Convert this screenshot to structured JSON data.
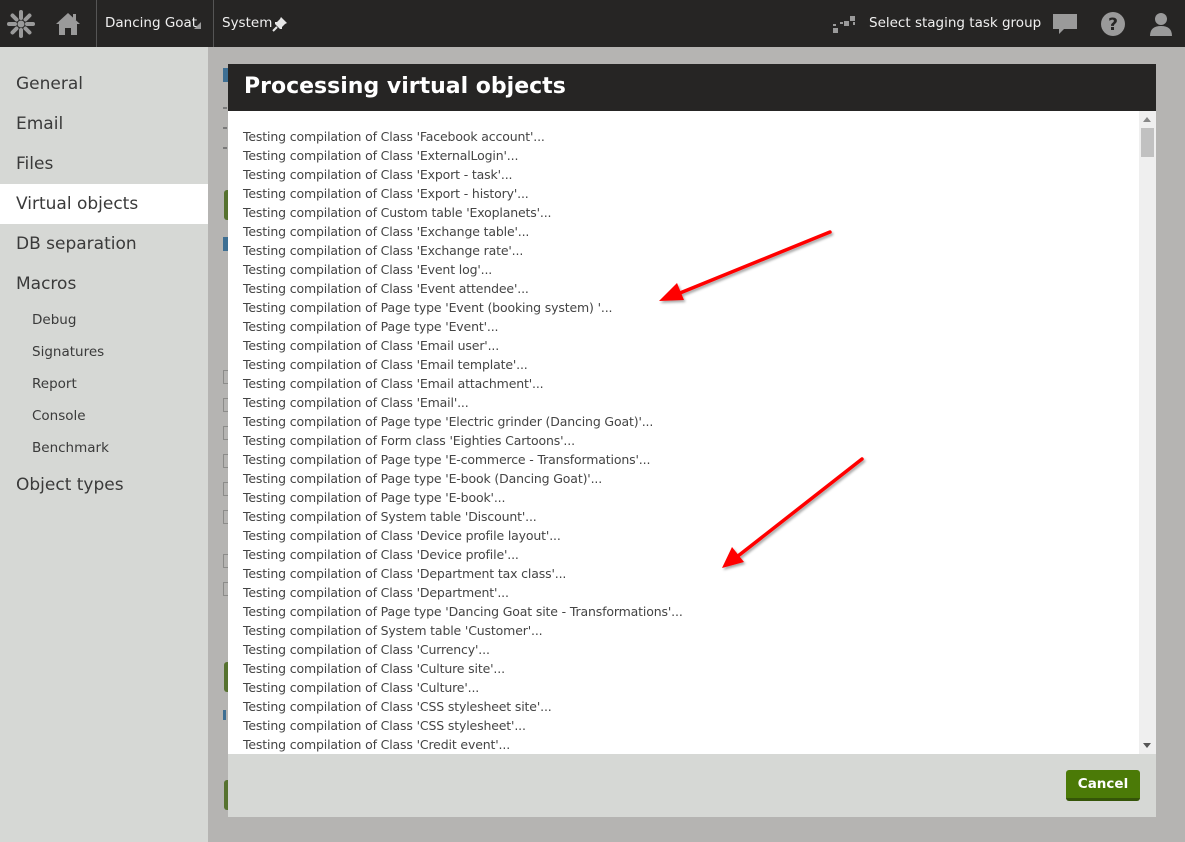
{
  "header": {
    "logo_icon": "kentico-logo-icon",
    "home_icon": "home-icon",
    "site_name": "Dancing Goat",
    "app_name": "System",
    "pin_icon": "pin-icon",
    "staging_label": "Select staging task group",
    "chat_icon": "chat-icon",
    "help_icon": "help-icon",
    "user_icon": "user-icon"
  },
  "sidebar": {
    "items": [
      {
        "label": "General"
      },
      {
        "label": "Email"
      },
      {
        "label": "Files"
      },
      {
        "label": "Virtual objects",
        "active": true
      },
      {
        "label": "DB separation"
      },
      {
        "label": "Macros"
      }
    ],
    "macro_subitems": [
      {
        "label": "Debug"
      },
      {
        "label": "Signatures"
      },
      {
        "label": "Report"
      },
      {
        "label": "Console"
      },
      {
        "label": "Benchmark"
      }
    ],
    "last_item": {
      "label": "Object types"
    }
  },
  "dialog": {
    "title": "Processing virtual objects",
    "log_lines": [
      "Testing compilation of Class 'Facebook account'...",
      "Testing compilation of Class 'ExternalLogin'...",
      "Testing compilation of Class 'Export - task'...",
      "Testing compilation of Class 'Export - history'...",
      "Testing compilation of Custom table 'Exoplanets'...",
      "Testing compilation of Class 'Exchange table'...",
      "Testing compilation of Class 'Exchange rate'...",
      "Testing compilation of Class 'Event log'...",
      "Testing compilation of Class 'Event attendee'...",
      "Testing compilation of Page type 'Event (booking system) '...",
      "Testing compilation of Page type 'Event'...",
      "Testing compilation of Class 'Email user'...",
      "Testing compilation of Class 'Email template'...",
      "Testing compilation of Class 'Email attachment'...",
      "Testing compilation of Class 'Email'...",
      "Testing compilation of Page type 'Electric grinder (Dancing Goat)'...",
      "Testing compilation of Form class 'Eighties Cartoons'...",
      "Testing compilation of Page type 'E-commerce - Transformations'...",
      "Testing compilation of Page type 'E-book (Dancing Goat)'...",
      "Testing compilation of Page type 'E-book'...",
      "Testing compilation of System table 'Discount'...",
      "Testing compilation of Class 'Device profile layout'...",
      "Testing compilation of Class 'Device profile'...",
      "Testing compilation of Class 'Department tax class'...",
      "Testing compilation of Class 'Department'...",
      "Testing compilation of Page type 'Dancing Goat site - Transformations'...",
      "Testing compilation of System table 'Customer'...",
      "Testing compilation of Class 'Currency'...",
      "Testing compilation of Class 'Culture site'...",
      "Testing compilation of Class 'Culture'...",
      "Testing compilation of Class 'CSS stylesheet site'...",
      "Testing compilation of Class 'CSS stylesheet'...",
      "Testing compilation of Class 'Credit event'..."
    ],
    "cancel_label": "Cancel"
  },
  "colors": {
    "header_bg": "#262524",
    "sidebar_bg": "#d6d8d5",
    "primary_button": "#4b7a07",
    "annotation_arrow": "#ff0000"
  }
}
